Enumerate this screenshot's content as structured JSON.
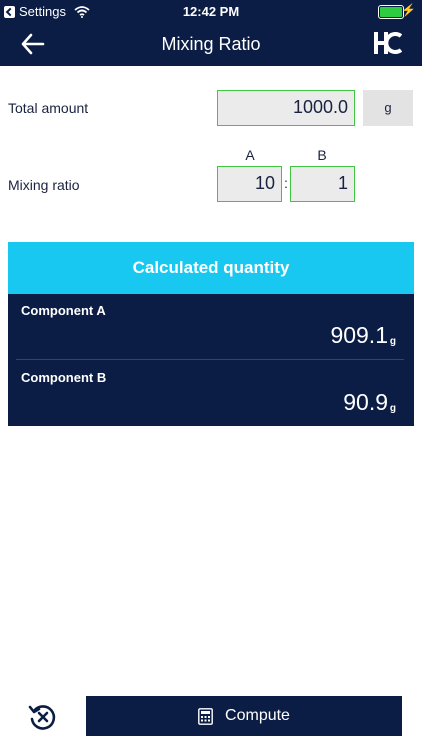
{
  "status_bar": {
    "back_app": "Settings",
    "time": "12:42 PM"
  },
  "nav": {
    "title": "Mixing Ratio",
    "logo_text": "HC"
  },
  "form": {
    "total_amount_label": "Total amount",
    "total_amount_value": "1000.0",
    "unit": "g",
    "mixing_ratio_label": "Mixing ratio",
    "col_a": "A",
    "col_b": "B",
    "ratio_a": "10",
    "separator": ":",
    "ratio_b": "1"
  },
  "results": {
    "header": "Calculated quantity",
    "items": [
      {
        "name": "Component A",
        "value": "909.1",
        "unit": "g"
      },
      {
        "name": "Component B",
        "value": "90.9",
        "unit": "g"
      }
    ]
  },
  "bottom": {
    "compute_label": "Compute"
  },
  "colors": {
    "navy": "#0b1d45",
    "accent": "#19c8f0",
    "field_border": "#41c641",
    "field_bg": "#ebebeb"
  }
}
